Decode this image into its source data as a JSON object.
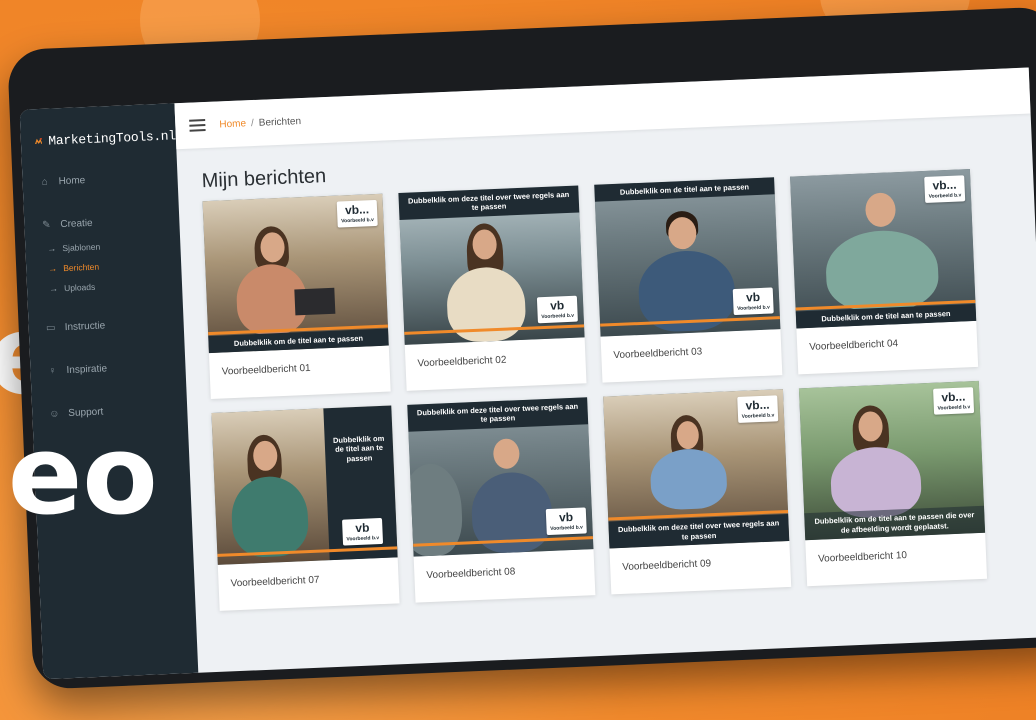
{
  "overlay_text": [
    "e",
    "leo"
  ],
  "logo": {
    "text": "MarketingTools.nl",
    "icon": "marketingtools-logo-icon"
  },
  "nav": [
    {
      "label": "Home",
      "icon": "home-icon",
      "sub": []
    },
    {
      "label": "Creatie",
      "icon": "palette-icon",
      "sub": [
        {
          "label": "Sjablonen",
          "active": false
        },
        {
          "label": "Berichten",
          "active": true
        },
        {
          "label": "Uploads",
          "active": false
        }
      ]
    },
    {
      "label": "Instructie",
      "icon": "monitor-icon",
      "sub": []
    },
    {
      "label": "Inspiratie",
      "icon": "lightbulb-icon",
      "sub": []
    },
    {
      "label": "Support",
      "icon": "support-icon",
      "sub": []
    }
  ],
  "breadcrumb": {
    "home": "Home",
    "sep": "/",
    "current": "Berichten"
  },
  "page_title": "Mijn berichten",
  "cards": [
    {
      "title": "Voorbeeldbericht 01",
      "banner": "Dubbelklik om de titel aan te passen",
      "badge": "Voorbeeld b.v",
      "badge_short": "vb..."
    },
    {
      "title": "Voorbeeldbericht 02",
      "banner": "Dubbelklik om deze titel over twee regels aan te passen",
      "badge": "Voorbeeld b.v",
      "badge_short": "vb"
    },
    {
      "title": "Voorbeeldbericht 03",
      "banner": "Dubbelklik om de titel aan te passen",
      "badge": "Voorbeeld b.v",
      "badge_short": "vb"
    },
    {
      "title": "Voorbeeldbericht 04",
      "banner": "Dubbelklik om de titel aan te passen",
      "badge": "Voorbeeld b.v",
      "badge_short": "vb..."
    },
    {
      "title": "Voorbeeldbericht 07",
      "banner": "Dubbelklik om de titel aan te passen",
      "badge": "Voorbeeld b.v",
      "badge_short": "vb"
    },
    {
      "title": "Voorbeeldbericht 08",
      "banner": "Dubbelklik om deze titel over twee regels aan te passen",
      "badge": "Voorbeeld b.v",
      "badge_short": "vb"
    },
    {
      "title": "Voorbeeldbericht 09",
      "banner": "Dubbelklik om deze titel over twee regels aan te passen",
      "badge": "Voorbeeld b.v",
      "badge_short": "vb..."
    },
    {
      "title": "Voorbeeldbericht 10",
      "banner": "Dubbelklik om de titel aan te passen die over de afbeelding wordt geplaatst.",
      "badge": "Voorbeeld b.v",
      "badge_short": "vb..."
    }
  ],
  "colors": {
    "accent": "#f08a2a",
    "sidebar": "#1f2b33",
    "background": "#f28a2c"
  }
}
